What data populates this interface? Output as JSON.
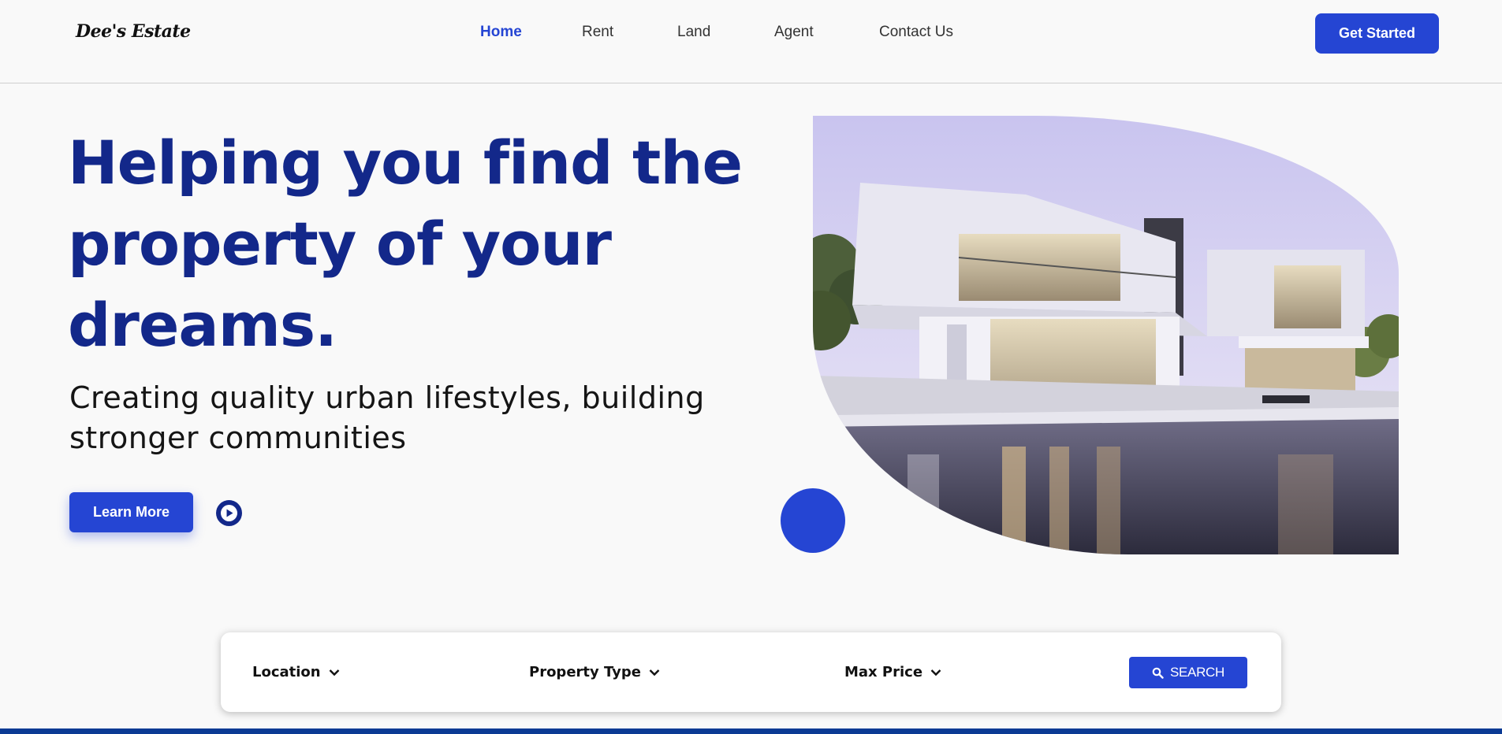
{
  "header": {
    "logo": "Dee's Estate",
    "nav": [
      {
        "label": "Home",
        "active": true
      },
      {
        "label": "Rent",
        "active": false
      },
      {
        "label": "Land",
        "active": false
      },
      {
        "label": "Agent",
        "active": false
      },
      {
        "label": "Contact Us",
        "active": false
      }
    ],
    "cta_label": "Get Started"
  },
  "hero": {
    "title_lines": [
      "Helping you find the",
      "property of your",
      "dreams."
    ],
    "subtitle_lines": [
      "Creating quality urban lifestyles, building",
      "stronger communities"
    ],
    "learn_more_label": "Learn More",
    "play_icon": "play-circle-icon",
    "image_subject": "modern-house-with-pool"
  },
  "search": {
    "filters": [
      {
        "label": "Location",
        "icon": "chevron-down-icon"
      },
      {
        "label": "Property Type",
        "icon": "chevron-down-icon"
      },
      {
        "label": "Max Price",
        "icon": "chevron-down-icon"
      }
    ],
    "button_label": "SEARCH",
    "button_icon": "search-icon"
  },
  "colors": {
    "accent": "#2545d3",
    "heading": "#13288a",
    "background": "#f9f9f9",
    "footer_strip": "#0b3a94"
  }
}
